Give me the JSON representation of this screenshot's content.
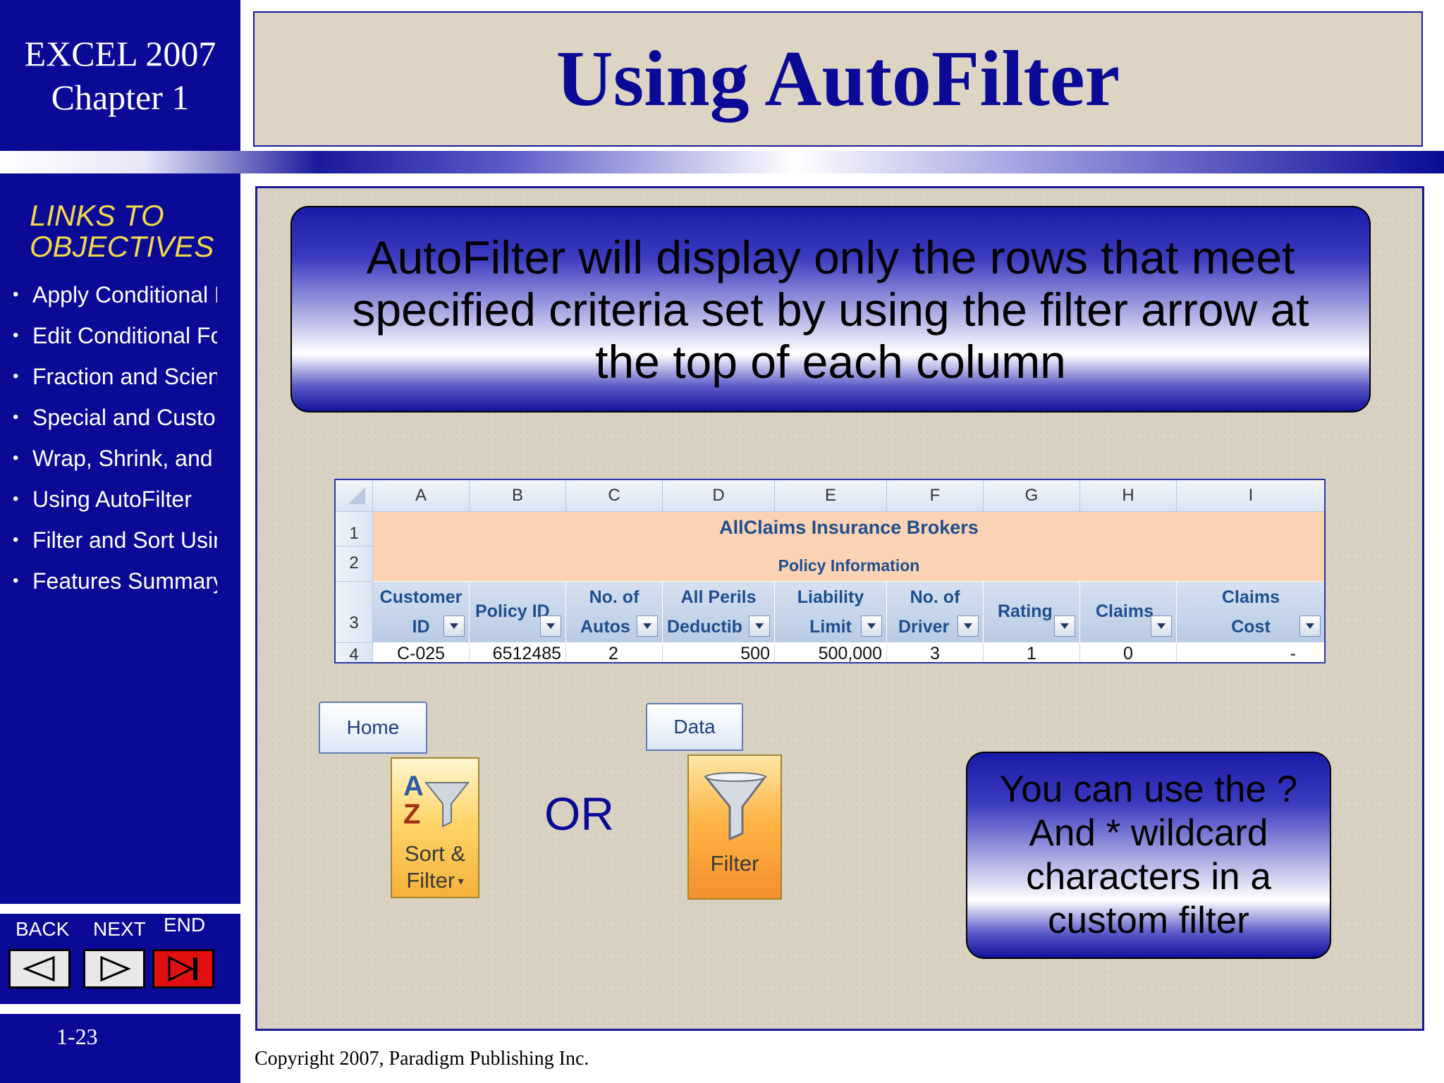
{
  "sidebar": {
    "chapter_line1": "EXCEL 2007",
    "chapter_line2": "Chapter 1",
    "links_heading_line1": "LINKS TO",
    "links_heading_line2": "OBJECTIVES",
    "objectives": [
      "Apply Conditional Fo",
      "Edit Conditional Forn",
      "Fraction and Scientifi",
      "Special and Custom",
      "Wrap, Shrink, and Mi",
      "Using AutoFilter",
      "Filter and Sort Using",
      "Features Summary"
    ],
    "nav": {
      "back": "BACK",
      "next": "NEXT",
      "end": "END"
    },
    "page_number": "1-23"
  },
  "slide": {
    "title": "Using AutoFilter",
    "main_callout": "AutoFilter will display only the rows that meet specified criteria set by using the filter arrow at the top of each column",
    "tip_callout": "You can use the ? And * wildcard characters in a custom filter",
    "or_label": "OR",
    "copyright": "Copyright 2007, Paradigm Publishing Inc."
  },
  "sheet": {
    "columns": [
      "A",
      "B",
      "C",
      "D",
      "E",
      "F",
      "G",
      "H",
      "I"
    ],
    "rows": [
      "1",
      "2",
      "3",
      "4"
    ],
    "title": "AllClaims Insurance Brokers",
    "subtitle": "Policy Information",
    "headers": [
      [
        "Customer",
        "ID"
      ],
      [
        "Policy ID",
        ""
      ],
      [
        "No. of",
        "Autos"
      ],
      [
        "All Perils",
        "Deductib"
      ],
      [
        "Liability",
        "Limit"
      ],
      [
        "No. of",
        "Driver"
      ],
      [
        "Rating",
        ""
      ],
      [
        "Claims",
        ""
      ],
      [
        "Claims",
        "Cost"
      ]
    ],
    "data_row": [
      "C-025",
      "6512485",
      "2",
      "500",
      "500,000",
      "3",
      "1",
      "0",
      "-"
    ]
  },
  "ribbon": {
    "home_tab": "Home",
    "data_tab": "Data",
    "sort_filter_line1": "Sort &",
    "sort_filter_line2": "Filter",
    "filter_label": "Filter"
  },
  "colors": {
    "sidebar_blue": "#0a0a96",
    "title_blue": "#0a0a96",
    "links_heading_yellow": "#f2d84a",
    "panel_beige": "#d9d2c2",
    "sheet_title_band": "#fbd3b4",
    "end_button_red": "#e01010"
  }
}
